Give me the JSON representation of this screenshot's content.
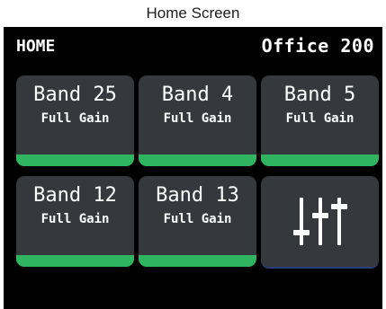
{
  "caption": "Home Screen",
  "header": {
    "title": "HOME",
    "location": "Office 200"
  },
  "tiles": [
    {
      "name": "Band 25",
      "status": "Full Gain"
    },
    {
      "name": "Band 4",
      "status": "Full Gain"
    },
    {
      "name": "Band 5",
      "status": "Full Gain"
    },
    {
      "name": "Band 12",
      "status": "Full Gain"
    },
    {
      "name": "Band 13",
      "status": "Full Gain"
    }
  ],
  "settings_tile": {
    "icon": "mixer-sliders-icon"
  },
  "colors": {
    "screen_background": "#000000",
    "tile_background": "#35383c",
    "status_bar": "#2fb55f",
    "text": "#ffffff"
  }
}
